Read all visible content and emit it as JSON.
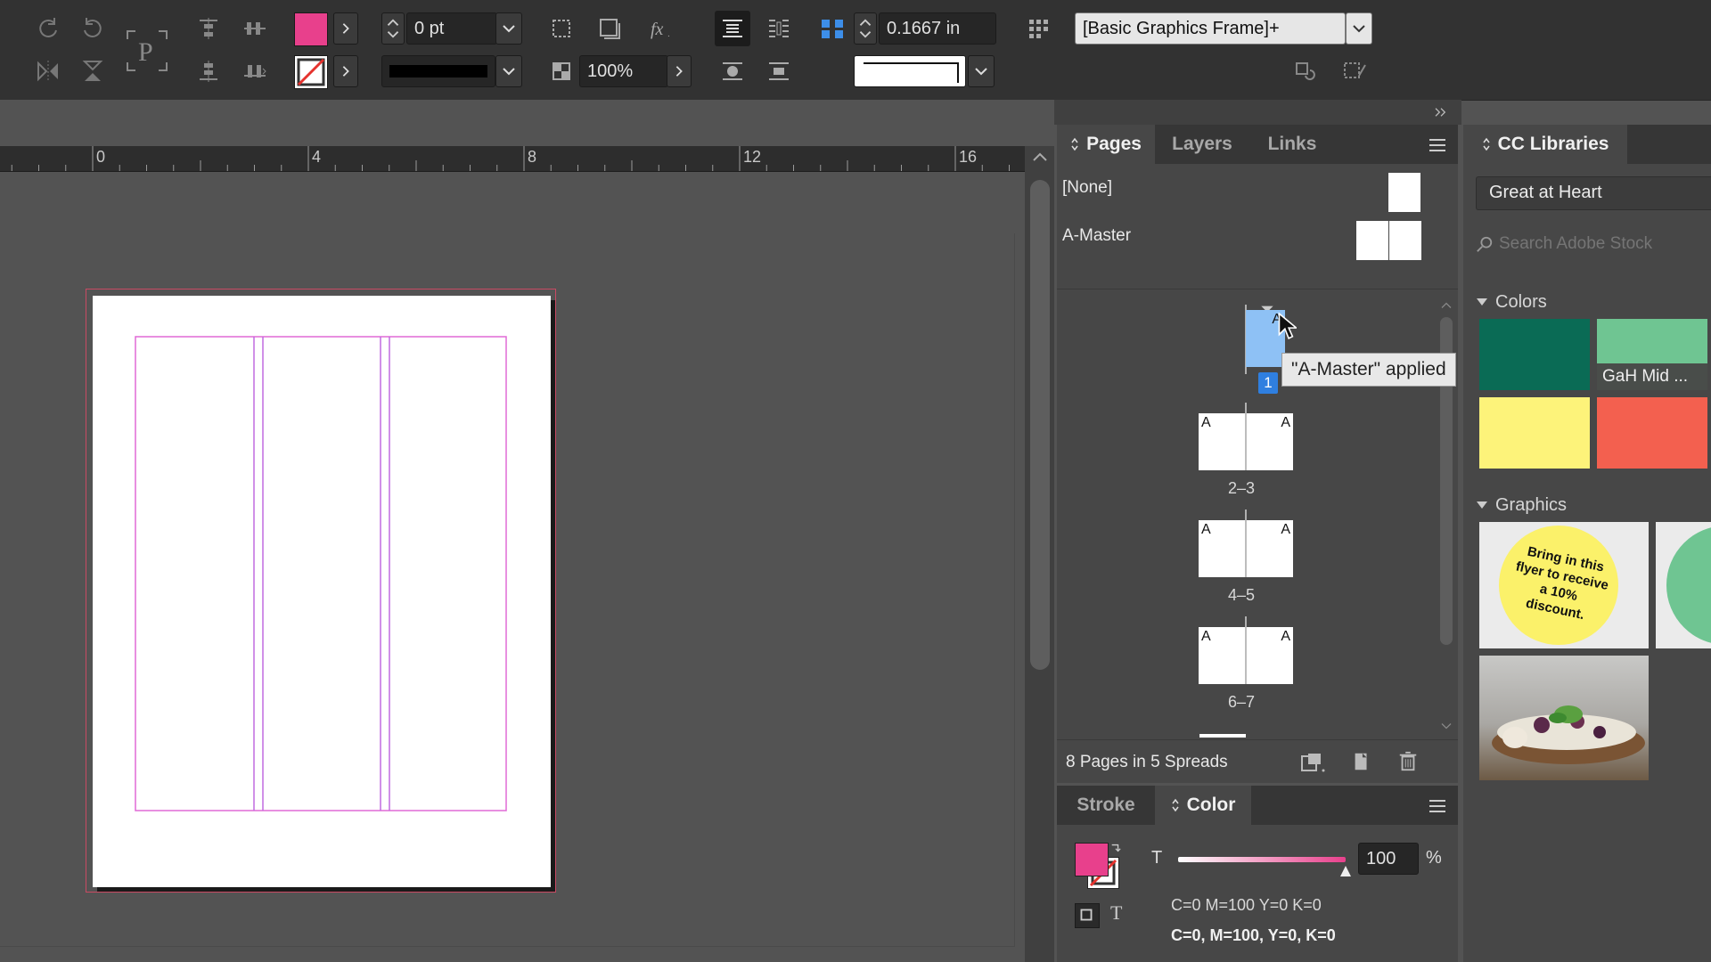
{
  "control_bar": {
    "fill_color": "#e8408c",
    "stroke_weight": "0 pt",
    "opacity": "100%",
    "offset": "0.1667 in",
    "object_style": "[Basic Graphics Frame]+",
    "accent_blue": "#3d8ee8"
  },
  "ruler": {
    "ticks": [
      "0",
      "4",
      "8",
      "12",
      "16"
    ]
  },
  "pages_panel": {
    "tabs": [
      {
        "label": "Pages",
        "active": true
      },
      {
        "label": "Layers",
        "active": false
      },
      {
        "label": "Links",
        "active": false
      }
    ],
    "masters": [
      {
        "label": "[None]"
      },
      {
        "label": "A-Master"
      }
    ],
    "spreads": [
      {
        "label": "1",
        "left_letter": "",
        "right_letter": "A",
        "selected": true
      },
      {
        "label": "2–3",
        "left_letter": "A",
        "right_letter": "A"
      },
      {
        "label": "4–5",
        "left_letter": "A",
        "right_letter": "A"
      },
      {
        "label": "6–7",
        "left_letter": "A",
        "right_letter": "A"
      }
    ],
    "tooltip": "\"A-Master\" applied",
    "footer_status": "8 Pages in 5 Spreads"
  },
  "color_panel": {
    "tabs": [
      {
        "label": "Stroke",
        "active": false
      },
      {
        "label": "Color",
        "active": true
      }
    ],
    "tint_letter": "T",
    "tint_value": "100",
    "percent_sign": "%",
    "color_name_1": "C=0 M=100 Y=0 K=0",
    "color_name_2": "C=0, M=100, Y=0, K=0",
    "text_icon_letter": "T"
  },
  "cc_libraries": {
    "title": "CC Libraries",
    "library_name": "Great at Heart",
    "search_placeholder": "Search Adobe Stock",
    "colors_heading": "Colors",
    "colors": [
      {
        "hex": "#0a6b55",
        "label": ""
      },
      {
        "hex": "#6fc592",
        "label": "GaH Mid ..."
      },
      {
        "hex": "#fdf37a",
        "label": ""
      },
      {
        "hex": "#f3604f",
        "label": ""
      }
    ],
    "graphics_heading": "Graphics",
    "flyer_text": "Bring in this flyer to receive a 10% discount."
  }
}
